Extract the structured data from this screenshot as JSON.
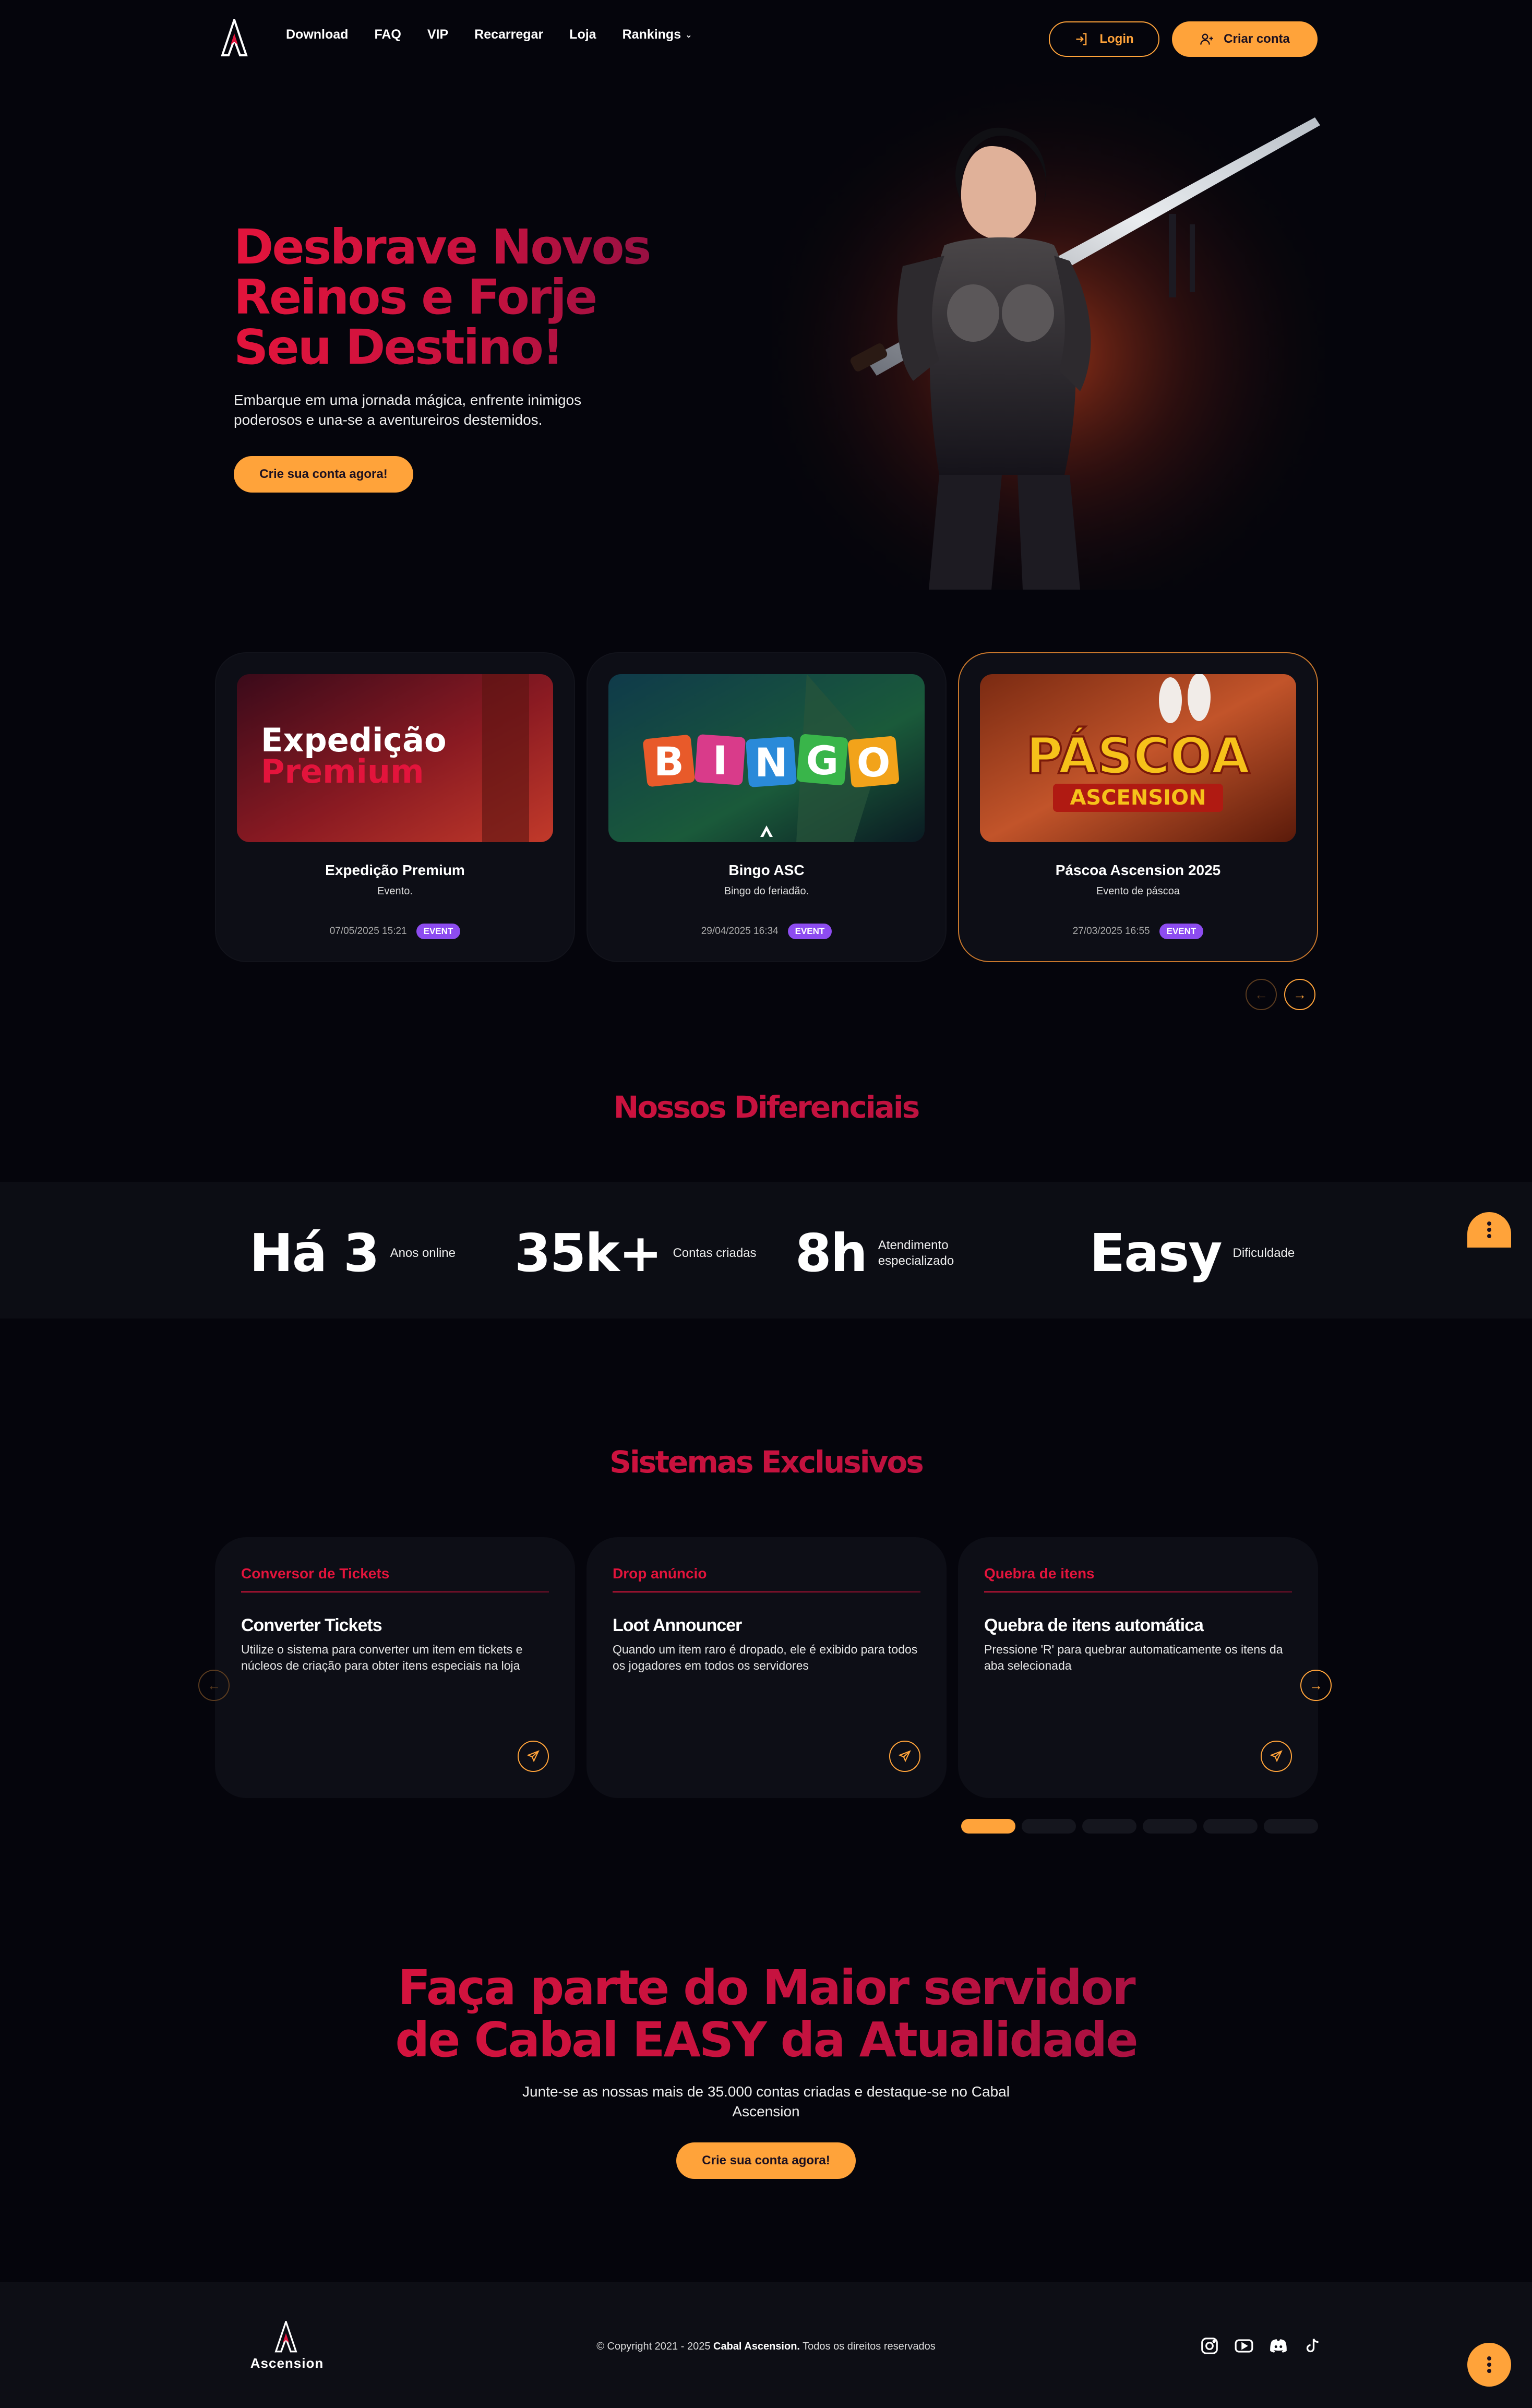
{
  "nav": {
    "links": [
      "Download",
      "FAQ",
      "VIP",
      "Recarregar",
      "Loja",
      "Rankings"
    ],
    "login_label": "Login",
    "signup_label": "Criar conta"
  },
  "hero": {
    "title_line1": "Desbrave Novos",
    "title_line2": "Reinos e Forje",
    "title_line3": "Seu Destino!",
    "subtitle_line1": "Embarque em uma jornada mágica, enfrente inimigos",
    "subtitle_line2": "poderosos e una-se a aventureiros destemidos.",
    "cta_label": "Crie sua conta agora!"
  },
  "news": [
    {
      "thumb_line1": "Expedição",
      "thumb_line2": "Premium",
      "title": "Expedição Premium",
      "desc": "Evento.",
      "date": "07/05/2025 15:21",
      "tag": "EVENT"
    },
    {
      "thumb_letters": [
        "B",
        "I",
        "N",
        "G",
        "O"
      ],
      "title": "Bingo ASC",
      "desc": "Bingo do feriadão.",
      "date": "29/04/2025 16:34",
      "tag": "EVENT"
    },
    {
      "thumb_line1": "PÁSCOA",
      "thumb_line2": "ASCENSION",
      "title": "Páscoa Ascension 2025",
      "desc": "Evento de páscoa",
      "date": "27/03/2025 16:55",
      "tag": "EVENT"
    }
  ],
  "diferenciais": {
    "title": "Nossos Diferenciais",
    "stats": [
      {
        "value": "Há 3",
        "label_line1": "Anos online",
        "label_line2": ""
      },
      {
        "value": "35k+",
        "label_line1": "Contas criadas",
        "label_line2": ""
      },
      {
        "value": "8h",
        "label_line1": "Atendimento",
        "label_line2": "especializado"
      },
      {
        "value": "Easy",
        "label_line1": "Dificuldade",
        "label_line2": ""
      }
    ]
  },
  "sistemas": {
    "title": "Sistemas Exclusivos",
    "cards": [
      {
        "tag": "Conversor de Tickets",
        "heading": "Converter Tickets",
        "text": "Utilize o sistema para converter um item em tickets e núcleos de criação para obter itens especiais na loja"
      },
      {
        "tag": "Drop anúncio",
        "heading": "Loot Announcer",
        "text": "Quando um item raro é dropado, ele é exibido para todos os jogadores em todos os servidores"
      },
      {
        "tag": "Quebra de itens",
        "heading": "Quebra de itens automática",
        "text": "Pressione 'R' para quebrar automaticamente os itens da aba selecionada"
      }
    ],
    "pages_total": 6,
    "page_active": 1
  },
  "cta": {
    "title_line1": "Faça parte do Maior servidor",
    "title_line2": "de Cabal EASY da Atualidade",
    "subtitle_line1": "Junte-se as nossas mais de 35.000 contas criadas e destaque-se no Cabal",
    "subtitle_line2": "Ascension",
    "button_label": "Crie sua conta agora!"
  },
  "footer": {
    "logo_text": "Ascension",
    "copyright_prefix": "© Copyright 2021 - 2025 ",
    "copyright_brand": "Cabal Ascension.",
    "copyright_suffix": " Todos os direitos reservados",
    "socials": [
      "instagram-icon",
      "youtube-icon",
      "discord-icon",
      "tiktok-icon"
    ]
  },
  "colors": {
    "accent": "#ffa33a",
    "brand_red": "#e3143c",
    "badge_purple": "#8d4cf0",
    "background": "#05050c"
  }
}
